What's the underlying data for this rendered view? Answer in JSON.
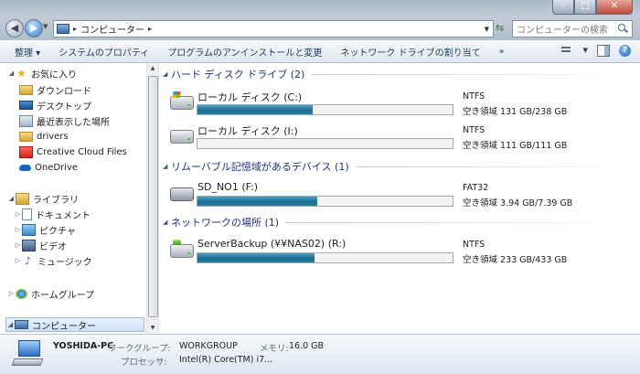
{
  "window": {
    "caption_buttons": {
      "minimize": "–",
      "maximize": "□",
      "close": "✕"
    }
  },
  "address_bar": {
    "crumbs": [
      "コンピューター"
    ],
    "icon": "computer-icon"
  },
  "search": {
    "placeholder": "コンピューターの検索"
  },
  "toolbar": {
    "items": [
      "整理 ▾",
      "システムのプロパティ",
      "プログラムのアンインストールと変更",
      "ネットワーク ドライブの割り当て",
      "»"
    ]
  },
  "nav_pane": {
    "favorites": {
      "label": "お気に入り",
      "items": [
        "ダウンロード",
        "デスクトップ",
        "最近表示した場所",
        "drivers",
        "Creative Cloud Files",
        "OneDrive"
      ]
    },
    "libraries": {
      "label": "ライブラリ",
      "items": [
        "ドキュメント",
        "ピクチャ",
        "ビデオ",
        "ミュージック"
      ]
    },
    "homegroup": {
      "label": "ホームグループ"
    },
    "computer": {
      "label": "コンピューター"
    }
  },
  "groups": [
    {
      "title": "ハード ディスク ドライブ (2)",
      "drives": [
        {
          "name": "ローカル ディスク (C:)",
          "fs": "NTFS",
          "free": "空き領域 131 GB/238 GB",
          "used_fraction": 0.45,
          "icon": "system-hdd-icon"
        },
        {
          "name": "ローカル ディスク (I:)",
          "fs": "NTFS",
          "free": "空き領域 111 GB/111 GB",
          "used_fraction": 0.0,
          "icon": "hdd-icon"
        }
      ]
    },
    {
      "title": "リムーバブル記憶域があるデバイス (1)",
      "drives": [
        {
          "name": "SD_NO1 (F:)",
          "fs": "FAT32",
          "free": "空き領域 3.94 GB/7.39 GB",
          "used_fraction": 0.47,
          "icon": "sd-card-icon"
        }
      ]
    },
    {
      "title": "ネットワークの場所 (1)",
      "drives": [
        {
          "name": "ServerBackup (¥¥NAS02) (R:)",
          "fs": "NTFS",
          "free": "空き領域 233 GB/433 GB",
          "used_fraction": 0.46,
          "icon": "network-drive-icon"
        }
      ]
    }
  ],
  "details": {
    "pc_name": "YOSHIDA-PC",
    "workgroup_label": "ワークグループ:",
    "workgroup_value": "WORKGROUP",
    "memory_label": "メモリ:",
    "memory_value": "16.0 GB",
    "processor_label": "プロセッサ:",
    "processor_value": "Intel(R) Core(TM) i7..."
  },
  "colors": {
    "bar_fill": "#1d6d91",
    "group_title": "#1e3287",
    "link": "#1e395b"
  }
}
